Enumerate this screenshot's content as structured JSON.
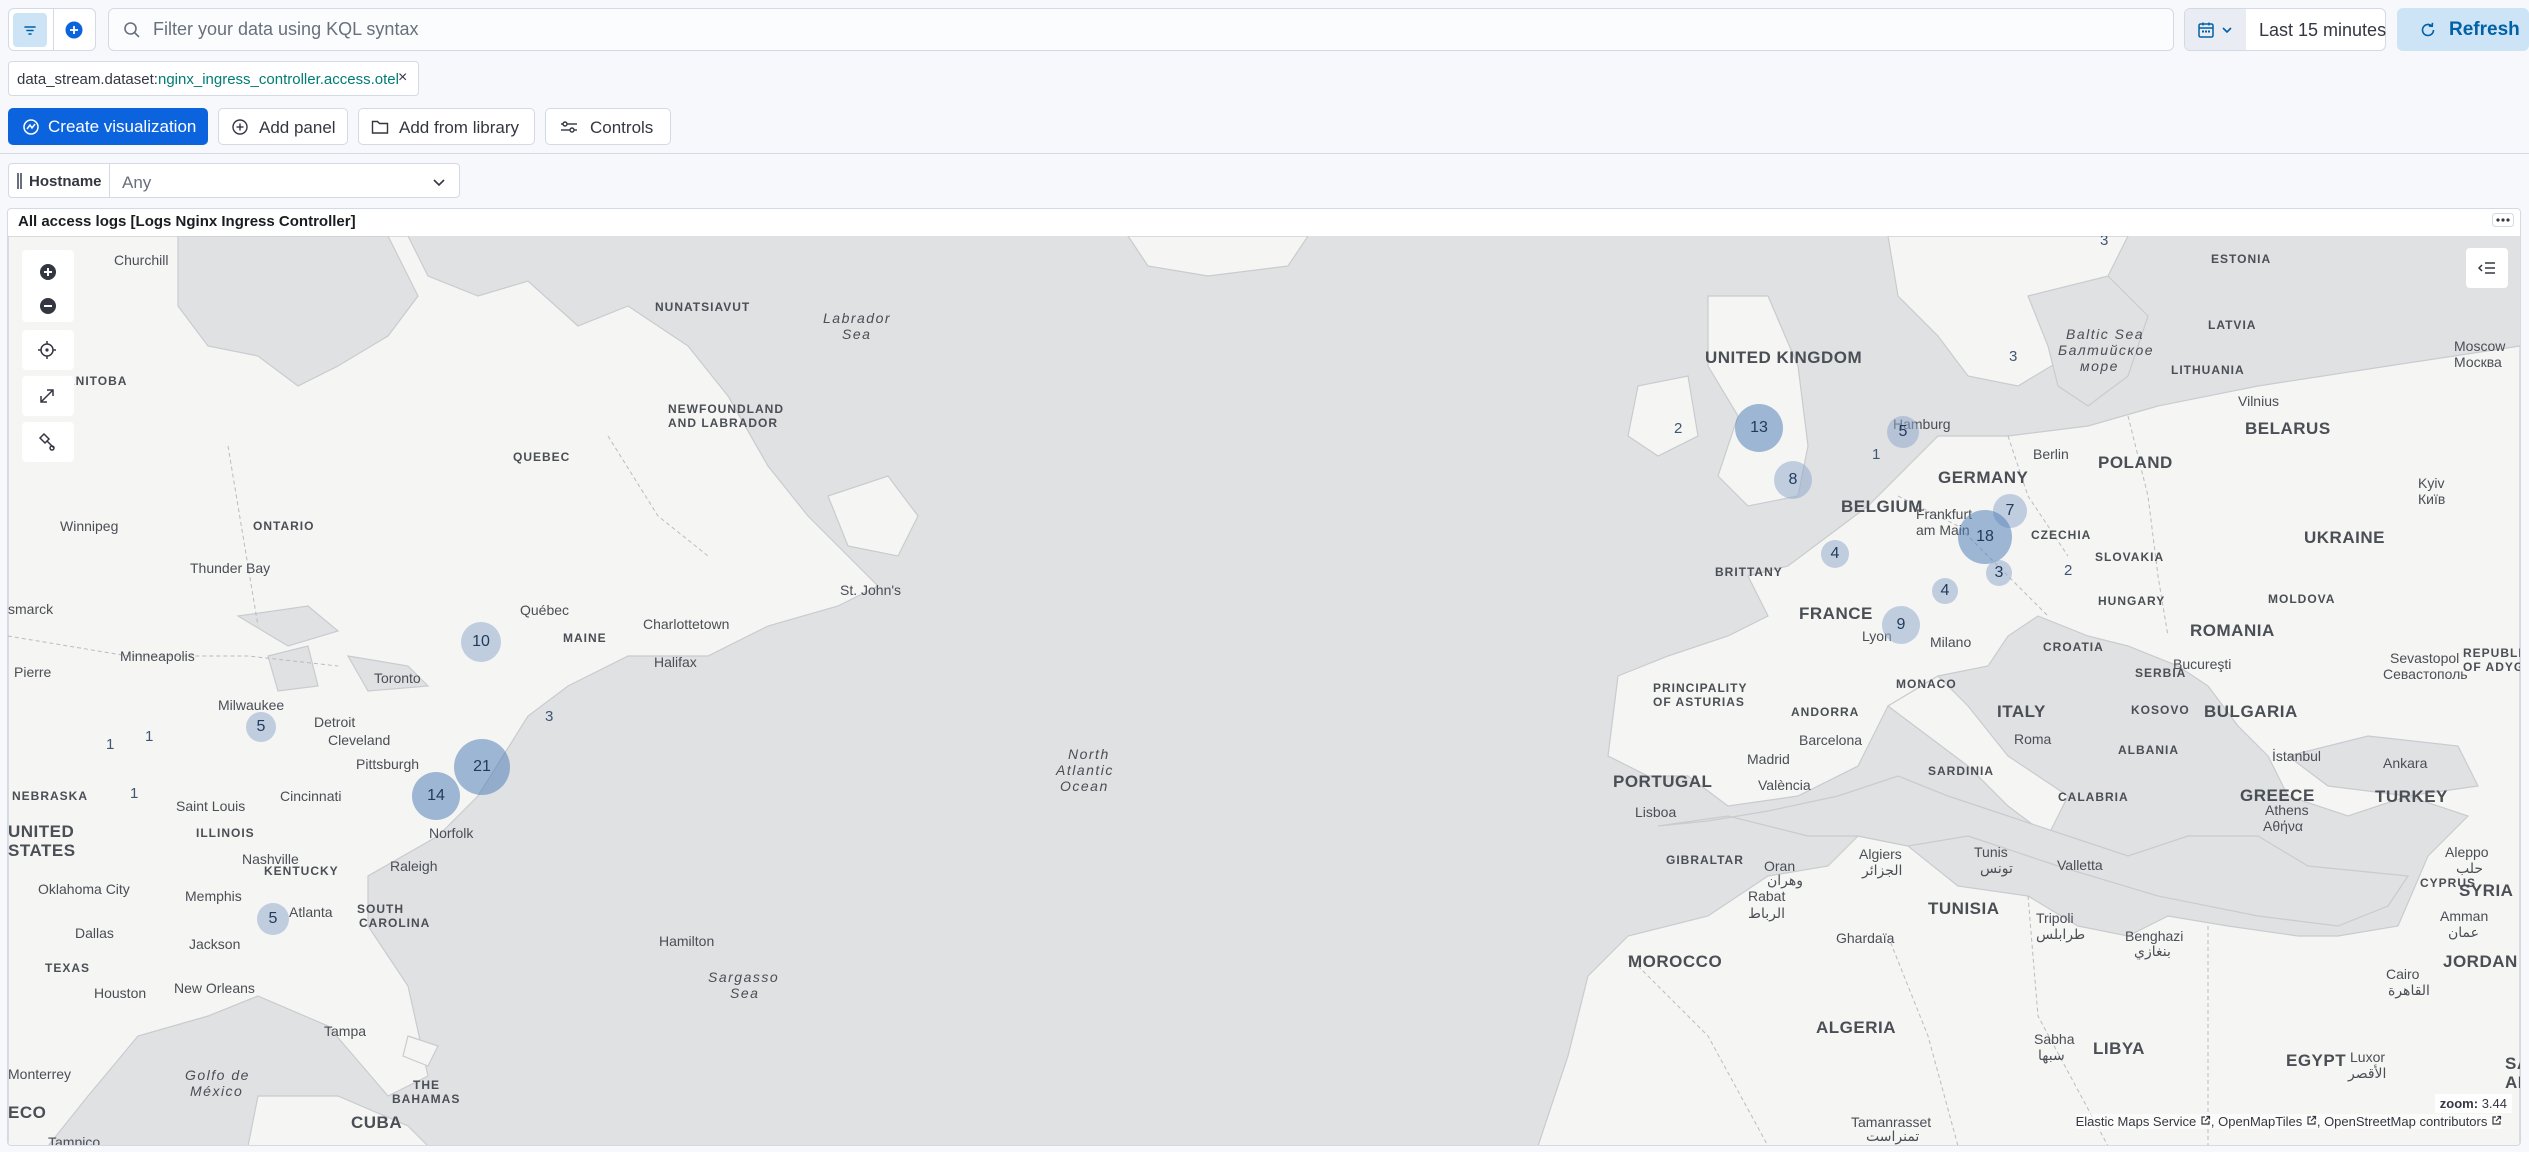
{
  "query_bar": {
    "kql_placeholder": "Filter your data using KQL syntax",
    "date_range": "Last 15 minutes",
    "refresh_label": "Refresh"
  },
  "filter_pill": {
    "field": "data_stream.dataset:",
    "value": "nginx_ingress_controller.access.otel",
    "remove": "×"
  },
  "actions": {
    "create_visualization": "Create visualization",
    "add_panel": "Add panel",
    "add_from_library": "Add from library",
    "controls": "Controls"
  },
  "control": {
    "label": "Hostname",
    "value": "Any"
  },
  "panel": {
    "title": "All access logs [Logs Nginx Ingress Controller]"
  },
  "map": {
    "clusters": [
      "3",
      "3",
      "13",
      "2",
      "5",
      "1",
      "8",
      "7",
      "18",
      "4",
      "3",
      "2",
      "4",
      "9",
      "10",
      "5",
      "1",
      "1",
      "3",
      "21",
      "14",
      "1",
      "5"
    ],
    "countries": [
      "UNITED KINGDOM",
      "GERMANY",
      "POLAND",
      "BELGIUM",
      "CZECHIA",
      "SLOVAKIA",
      "UKRAINE",
      "BELARUS",
      "LITHUANIA",
      "LATVIA",
      "ESTONIA",
      "MOLDOVA",
      "HUNGARY",
      "ROMANIA",
      "FRANCE",
      "CROATIA",
      "SERBIA",
      "BULGARIA",
      "KOSOVO",
      "ALBANIA",
      "MONACO",
      "ITALY",
      "ANDORRA",
      "PORTUGAL",
      "GREECE",
      "TURKEY",
      "SYRIA",
      "CYPRUS",
      "JORDAN",
      "TUNISIA",
      "MOROCCO",
      "ALGERIA",
      "LIBYA",
      "EGYPT",
      "UNITED",
      "STATES",
      "TEXAS",
      "NEBRASKA",
      "ILLINOIS",
      "KENTUCKY",
      "SOUTH",
      "CAROLINA",
      "MAINE",
      "THE",
      "BAHAMAS",
      "CUBA",
      "ECO",
      "REPUBLIC",
      "OF ADYGE",
      "SA",
      "AR"
    ],
    "regions": [
      "NUNATSIAVUT",
      "NEWFOUNDLAND",
      "AND LABRADOR",
      "QUEBEC",
      "ONTARIO",
      "MANITOBA",
      "BRITTANY",
      "PRINCIPALITY",
      "OF ASTURIAS",
      "SARDINIA",
      "CALABRIA",
      "GIBRALTAR"
    ],
    "cities": [
      "Churchill",
      "Winnipeg",
      "Thunder Bay",
      "Minneapolis",
      "Milwaukee",
      "Detroit",
      "Toronto",
      "Québec",
      "Charlottetown",
      "Halifax",
      "St. John's",
      "Cleveland",
      "Pittsburgh",
      "Cincinnati",
      "Saint Louis",
      "Nashville",
      "Memphis",
      "Oklahoma City",
      "Dallas",
      "Houston",
      "New Orleans",
      "Jackson",
      "Atlanta",
      "Raleigh",
      "Norfolk",
      "Tampa",
      "Hamilton",
      "Tampico",
      "Monterrey",
      "smarck",
      "Pierre",
      "Hamburg",
      "Berlin",
      "Frankfurt",
      "am Main",
      "Lyon",
      "Milano",
      "Barcelona",
      "Madrid",
      "València",
      "Lisboa",
      "Roma",
      "Oran",
      "وهران",
      "Algiers",
      "الجزائر",
      "Tunis",
      "تونس",
      "Valletta",
      "Tripoli",
      "طرابلس",
      "Benghazi",
      "بنغازي",
      "Sabha",
      "سبها",
      "Ghardaïa",
      "Rabat",
      "الرباط",
      "Tamanrasset",
      "تمنراست",
      "Athens",
      "Αθήνα",
      "İstanbul",
      "Ankara",
      "Aleppo",
      "حلب",
      "Amman",
      "عمان",
      "Cairo",
      "القاهرة",
      "Luxor",
      "الأقصر",
      "Bucureşti",
      "Sevastopol",
      "Севастополь",
      "Kyiv",
      "Київ",
      "Vilnius",
      "Moscow",
      "Москва"
    ],
    "seas": [
      "Labrador",
      "Sea",
      "North",
      "Atlantic",
      "Ocean",
      "Sargasso",
      "Sea",
      "Golfo de",
      "México",
      "Baltic Sea",
      "Балтийское",
      "море"
    ],
    "zoom_label": "zoom:",
    "zoom_value": "3.44",
    "attribution": [
      "Elastic Maps Service",
      "OpenMapTiles",
      "OpenStreetMap contributors"
    ]
  },
  "colors": {
    "primary": "#0b64dd",
    "refresh_bg": "#cce4f5",
    "refresh_text": "#0061a6",
    "filter_value": "#017d73",
    "map_bg": "#dfe1e3",
    "land": "#f5f5f3",
    "cluster": "#5481b8"
  },
  "icons": [
    "filter-icon",
    "plus-circle-icon",
    "search-icon",
    "calendar-icon",
    "chevron-down-icon",
    "refresh-icon",
    "close-icon",
    "visualize-icon",
    "plus-icon",
    "folder-icon",
    "controls-icon",
    "grip-icon",
    "menu-dots-icon",
    "zoom-in-icon",
    "zoom-out-icon",
    "crosshair-icon",
    "expand-icon",
    "draw-icon",
    "legend-icon",
    "external-link-icon"
  ]
}
